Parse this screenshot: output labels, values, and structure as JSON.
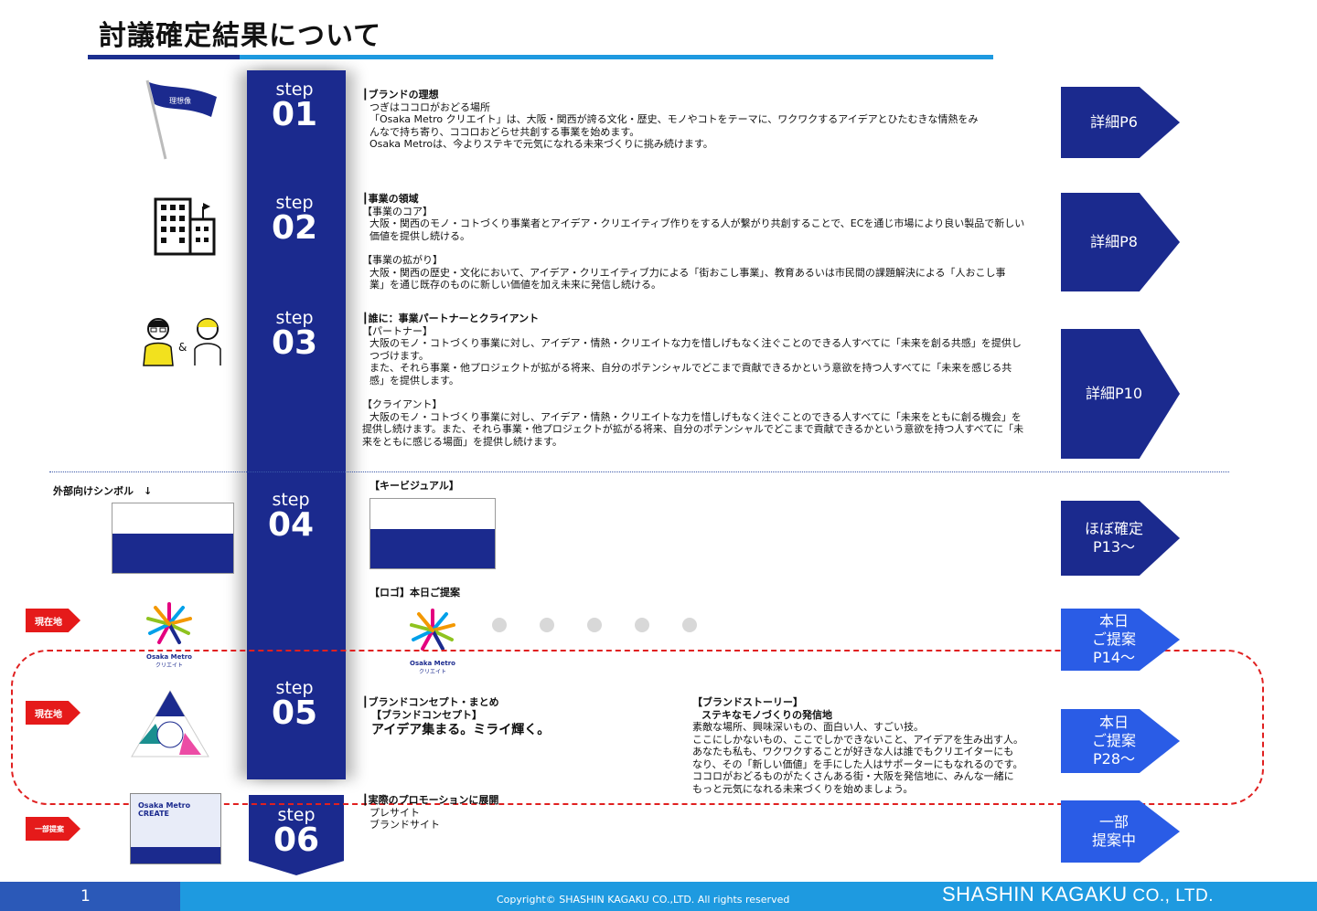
{
  "title": "討議確定結果について",
  "steps": [
    {
      "word": "step",
      "num": "01"
    },
    {
      "word": "step",
      "num": "02"
    },
    {
      "word": "step",
      "num": "03"
    },
    {
      "word": "step",
      "num": "04"
    },
    {
      "word": "step",
      "num": "05"
    },
    {
      "word": "step",
      "num": "06"
    }
  ],
  "s1": {
    "heading": "┃ブランドの理想",
    "lines": [
      "つぎはココロがおどる場所",
      "「Osaka Metro クリエイト」は、大阪・関西が誇る文化・歴史、モノやコトをテーマに、ワクワクするアイデアとひたむきな情熱をみ",
      "んなで持ち寄り、ココロおどらせ共創する事業を始めます。",
      "Osaka Metroは、今よりステキで元気になれる未来づくりに挑み続けます。"
    ]
  },
  "s2": {
    "heading": "┃事業の領域",
    "core_label": "【事業のコア】",
    "core_lines": [
      "大阪・関西のモノ・コトづくり事業者とアイデア・クリエイティブ作りをする人が繋がり共創することで、ECを通じ市場により良い製品で新しい",
      "価値を提供し続ける。"
    ],
    "expand_label": "【事業の拡がり】",
    "expand_lines": [
      "大阪・関西の歴史・文化において、アイデア・クリエイティブ力による「街おこし事業」、教育あるいは市民間の課題解決による「人おこし事",
      "業」を通じ既存のものに新しい価値を加え未来に発信し続ける。"
    ]
  },
  "s3": {
    "heading": "┃誰に：事業パートナーとクライアント",
    "partner_label": "【パートナー】",
    "partner_lines": [
      "大阪のモノ・コトづくり事業に対し、アイデア・情熱・クリエイトな力を惜しげもなく注ぐことのできる人すべてに「未来を創る共感」を提供し",
      "つづけます。",
      "また、それら事業・他プロジェクトが拡がる将来、自分のポテンシャルでどこまで貢献できるかという意欲を持つ人すべてに「未来を感じる共",
      "感」を提供します。"
    ],
    "client_label": "【クライアント】",
    "client_lines": [
      "大阪のモノ・コトづくり事業に対し、アイデア・情熱・クリエイトな力を惜しげもなく注ぐことのできる人すべてに「未来をともに創る機会」を",
      "提供し続けます。また、それら事業・他プロジェクトが拡がる将来、自分のポテンシャルでどこまで貢献できるかという意欲を持つ人すべてに「未",
      "来をともに感じる場面」を提供し続けます。"
    ]
  },
  "s4": {
    "external_symbol": "外部向けシンボル　↓",
    "kv_label": "【キービジュアル】",
    "logo_label": "【ロゴ】本日ご提案"
  },
  "s5": {
    "heading": "┃ブランドコンセプト・まとめ",
    "concept_label": "【ブランドコンセプト】",
    "concept": "アイデア集まる。ミライ輝く。",
    "story_label": "【ブランドストーリー】",
    "story_sub": "ステキなモノづくりの発信地",
    "story_lines": [
      "素敵な場所、興味深いもの、面白い人、すごい技。",
      "ここにしかないもの、ここでしかできないこと、アイデアを生み出す人。",
      "あなたも私も、ワクワクすることが好きな人は誰でもクリエイターにも",
      "なり、その「新しい価値」を手にした人はサポーターにもなれるのです。",
      "ココロがおどるものがたくさんある街・大阪を発信地に、みんな一緒に",
      "もっと元気になれる未来づくりを始めましょう。"
    ]
  },
  "s6": {
    "heading": "┃実際のプロモーションに展開",
    "lines": [
      "プレサイト",
      "ブランドサイト"
    ]
  },
  "arrows": [
    {
      "line1": "詳細P6",
      "line2": "",
      "line3": ""
    },
    {
      "line1": "詳細P8",
      "line2": "",
      "line3": ""
    },
    {
      "line1": "詳細P10",
      "line2": "",
      "line3": ""
    },
    {
      "line1": "ほぼ確定",
      "line2": "P13〜",
      "line3": ""
    },
    {
      "line1": "本日",
      "line2": "ご提案",
      "line3": "P14〜"
    },
    {
      "line1": "本日",
      "line2": "ご提案",
      "line3": "P28〜"
    },
    {
      "line1": "一部",
      "line2": "提案中",
      "line3": ""
    }
  ],
  "tags": [
    "現在地",
    "現在地",
    "一部提案"
  ],
  "flag_text": "理想像",
  "amp": "&",
  "logo_text": {
    "line1": "Osaka Metro",
    "line2": "クリエイト"
  },
  "site_thumb": {
    "line1": "Osaka Metro",
    "line2": "CREATE"
  },
  "footer": {
    "page": "1",
    "copyright": "Copyright© SHASHIN KAGAKU CO.,LTD. All rights reserved",
    "brand": "SHASHIN KAGAKU",
    "brand_suffix": " CO., LTD."
  },
  "colors": {
    "navy": "#1b2a8e",
    "accent_blue": "#1e9ae0",
    "light_arrow": "#2a5ce6",
    "red": "#e51a1a"
  }
}
